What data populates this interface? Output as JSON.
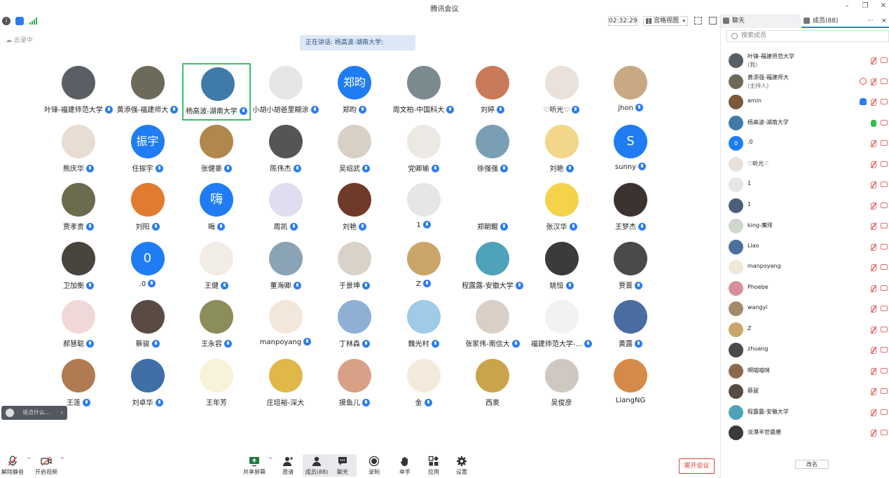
{
  "window": {
    "title": "腾讯会议"
  },
  "topbar": {
    "timer": "02:32:29",
    "view_label": "宫格视图"
  },
  "main": {
    "cloud_label": "云录中",
    "speaking": "正在讲话: 杨高波-湖南大学;",
    "chat_placeholder": "说点什么...",
    "participants": [
      {
        "name": "叶锋-福建师范大学",
        "bg": "#5a5f66",
        "initial": ""
      },
      {
        "name": "黄添强-福建师大",
        "bg": "#6d6a5a",
        "initial": ""
      },
      {
        "name": "杨高波-湖南大学",
        "bg": "#3f7aa8",
        "initial": "",
        "active": true
      },
      {
        "name": "小胡小胡爸里糊涂",
        "bg": "#e6e6e6",
        "initial": ""
      },
      {
        "name": "郑昀",
        "bg": "#1f7cf2",
        "initial": "郑昀"
      },
      {
        "name": "周文柏-中国科大",
        "bg": "#7b8a8f",
        "initial": ""
      },
      {
        "name": "刘婷",
        "bg": "#c97a5a",
        "initial": ""
      },
      {
        "name": "♡听光♡",
        "bg": "#e9e1da",
        "initial": ""
      },
      {
        "name": "jhon",
        "bg": "#c9a983",
        "initial": ""
      },
      {
        "name": "熊庆华",
        "bg": "#e8ddd2",
        "initial": ""
      },
      {
        "name": "任振宇",
        "bg": "#1f7cf2",
        "initial": "振宇"
      },
      {
        "name": "张健豪",
        "bg": "#b0884b",
        "initial": ""
      },
      {
        "name": "陈伟杰",
        "bg": "#555555",
        "initial": ""
      },
      {
        "name": "吴绍武",
        "bg": "#d8cfc5",
        "initial": ""
      },
      {
        "name": "党卿瑜",
        "bg": "#ece8e3",
        "initial": ""
      },
      {
        "name": "徐强强",
        "bg": "#7a9fb5",
        "initial": ""
      },
      {
        "name": "刘艳",
        "bg": "#f2d68a",
        "initial": ""
      },
      {
        "name": "sunny",
        "bg": "#1f7cf2",
        "initial": "S"
      },
      {
        "name": "贾孝贵",
        "bg": "#6b6b4e",
        "initial": ""
      },
      {
        "name": "刘阳",
        "bg": "#e07b2f",
        "initial": ""
      },
      {
        "name": "晦",
        "bg": "#1f7cf2",
        "initial": "嗨"
      },
      {
        "name": "周凯",
        "bg": "#e1dcef",
        "initial": ""
      },
      {
        "name": "刘艳",
        "bg": "#6f3a2a",
        "initial": ""
      },
      {
        "name": "1",
        "bg": "#e6e6e6",
        "initial": ""
      },
      {
        "name": "郑朝鲲",
        "bg": "#ffffff",
        "initial": ""
      },
      {
        "name": "张汉华",
        "bg": "#f4d34a",
        "initial": ""
      },
      {
        "name": "王梦杰",
        "bg": "#3a3330",
        "initial": ""
      },
      {
        "name": "卫加衡",
        "bg": "#4a443f",
        "initial": ""
      },
      {
        "name": ".0",
        "bg": "#1f7cf2",
        "initial": "0"
      },
      {
        "name": "王健",
        "bg": "#f2ece6",
        "initial": ""
      },
      {
        "name": "董海卿",
        "bg": "#8aa3b5",
        "initial": ""
      },
      {
        "name": "于景坤",
        "bg": "#d9d2c9",
        "initial": ""
      },
      {
        "name": "Z",
        "bg": "#caa56a",
        "initial": ""
      },
      {
        "name": "程露露-安徽大学",
        "bg": "#4fa3b9",
        "initial": ""
      },
      {
        "name": "姚恒",
        "bg": "#3d3a3a",
        "initial": ""
      },
      {
        "name": "贾晋",
        "bg": "#4a4a4a",
        "initial": ""
      },
      {
        "name": "郝慧聪",
        "bg": "#f1d8d8",
        "initial": ""
      },
      {
        "name": "蔡骏",
        "bg": "#5a4a44",
        "initial": ""
      },
      {
        "name": "王永容",
        "bg": "#8b8d5b",
        "initial": ""
      },
      {
        "name": "manpoyang",
        "bg": "#f3e6da",
        "initial": ""
      },
      {
        "name": "丁林森",
        "bg": "#8fb0d5",
        "initial": ""
      },
      {
        "name": "魏光村",
        "bg": "#9fcbe8",
        "initial": ""
      },
      {
        "name": "张家伟-南信大",
        "bg": "#d9cfc6",
        "initial": ""
      },
      {
        "name": "福建师范大学-...",
        "bg": "#f2f2f2",
        "initial": ""
      },
      {
        "name": "黄露",
        "bg": "#4a6ea1",
        "initial": ""
      },
      {
        "name": "王莲",
        "bg": "#b07a52",
        "initial": ""
      },
      {
        "name": "刘卓华",
        "bg": "#3f6fa6",
        "initial": ""
      },
      {
        "name": "王年芳",
        "bg": "#f7f2d9",
        "initial": ""
      },
      {
        "name": "庄培裕-深大",
        "bg": "#e0b84a",
        "initial": ""
      },
      {
        "name": "摸鱼儿",
        "bg": "#d9a088",
        "initial": ""
      },
      {
        "name": "金",
        "bg": "#f4eadc",
        "initial": ""
      },
      {
        "name": "西奥",
        "bg": "#caa44a",
        "initial": ""
      },
      {
        "name": "吴俊彦",
        "bg": "#cfc8c0",
        "initial": ""
      },
      {
        "name": "LiangNG",
        "bg": "#d68a4a",
        "initial": ""
      }
    ]
  },
  "bottombar": {
    "unmute": "解除静音",
    "start_video": "开启视频",
    "share": "共享屏幕",
    "invite": "邀请",
    "members": "成员(88)",
    "chat": "聊天",
    "record": "录制",
    "raise_hand": "举手",
    "apps": "应用",
    "settings": "设置",
    "leave": "离开会议"
  },
  "panel": {
    "tab_chat": "聊天",
    "tab_members": "成员(88)",
    "more": "···",
    "close": "×",
    "search_placeholder": "搜索成员",
    "rename": "改名",
    "members": [
      {
        "name": "叶锋-福建师范大学",
        "sub": "(我)",
        "bg": "#5a5f66",
        "initial": "",
        "mic": "off"
      },
      {
        "name": "黄添强-福建师大",
        "sub": "(主持人)",
        "bg": "#6d6a5a",
        "initial": "",
        "mic": "off"
      },
      {
        "name": "amin",
        "sub": "",
        "bg": "#7a5a3a",
        "initial": "",
        "mic": "off"
      },
      {
        "name": "杨高波-湖南大学",
        "sub": "",
        "bg": "#3f7aa8",
        "initial": "",
        "mic": "on"
      },
      {
        "name": ".0",
        "sub": "",
        "bg": "#1f7cf2",
        "initial": "0",
        "mic": "off"
      },
      {
        "name": "♡听光♡",
        "sub": "",
        "bg": "#e9e1da",
        "initial": "",
        "mic": "off"
      },
      {
        "name": "1",
        "sub": "",
        "bg": "#e6e6e6",
        "initial": "",
        "mic": "off"
      },
      {
        "name": "1",
        "sub": "",
        "bg": "#4a5f7a",
        "initial": "",
        "mic": "off"
      },
      {
        "name": "king-魔琲",
        "sub": "",
        "bg": "#cfd7cf",
        "initial": "",
        "mic": "off"
      },
      {
        "name": "Liao",
        "sub": "",
        "bg": "#4d6fa0",
        "initial": "",
        "mic": "off"
      },
      {
        "name": "manpoyang",
        "sub": "",
        "bg": "#f3e6da",
        "initial": "",
        "mic": "off"
      },
      {
        "name": "Phoebe",
        "sub": "",
        "bg": "#d88f9b",
        "initial": "",
        "mic": "off"
      },
      {
        "name": "wangyi",
        "sub": "",
        "bg": "#a58a6a",
        "initial": "",
        "mic": "off"
      },
      {
        "name": "Z",
        "sub": "",
        "bg": "#caa56a",
        "initial": "",
        "mic": "off"
      },
      {
        "name": "zhuang",
        "sub": "",
        "bg": "#4a4a4a",
        "initial": "",
        "mic": "off"
      },
      {
        "name": "啊喵喵咪",
        "sub": "",
        "bg": "#8a6a4a",
        "initial": "",
        "mic": "off"
      },
      {
        "name": "蔡骏",
        "sub": "",
        "bg": "#5a4a44",
        "initial": "",
        "mic": "off"
      },
      {
        "name": "程露露-安徽大学",
        "sub": "",
        "bg": "#4fa3b9",
        "initial": "",
        "mic": "off"
      },
      {
        "name": "淡漠半世盛唐",
        "sub": "",
        "bg": "#3a3a3a",
        "initial": "",
        "mic": "off"
      }
    ]
  },
  "colors": {
    "accent": "#2b7cf6",
    "active_border": "#3cbf6a",
    "danger": "#e0443a"
  }
}
